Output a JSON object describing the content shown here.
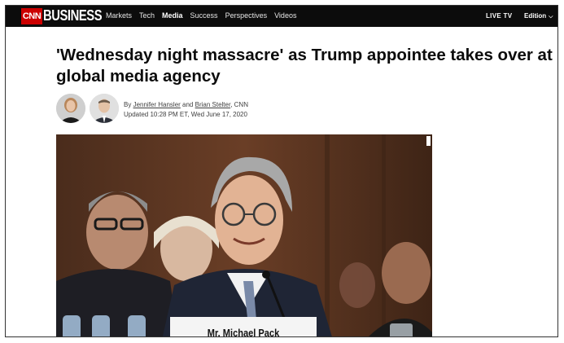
{
  "brand": {
    "cnn": "CNN",
    "business": "BUSINESS",
    "red": "#cc0000",
    "nav_bg": "#0c0c0c"
  },
  "nav": {
    "items": [
      "Markets",
      "Tech",
      "Media",
      "Success",
      "Perspectives",
      "Videos"
    ],
    "active": "Media",
    "live_tv": "LIVE TV",
    "edition": "Edition"
  },
  "article": {
    "headline_line1": "'Wednesday night massacre' as Trump appointee takes over at",
    "headline_line2": "global media agency",
    "by_prefix": "By ",
    "author1": "Jennifer Hansler",
    "and": " and ",
    "author2": "Brian Stelter",
    "source": ", CNN",
    "updated": "Updated 10:28 PM ET, Wed June 17, 2020",
    "photo_placard": "Mr. Michael Pack"
  }
}
